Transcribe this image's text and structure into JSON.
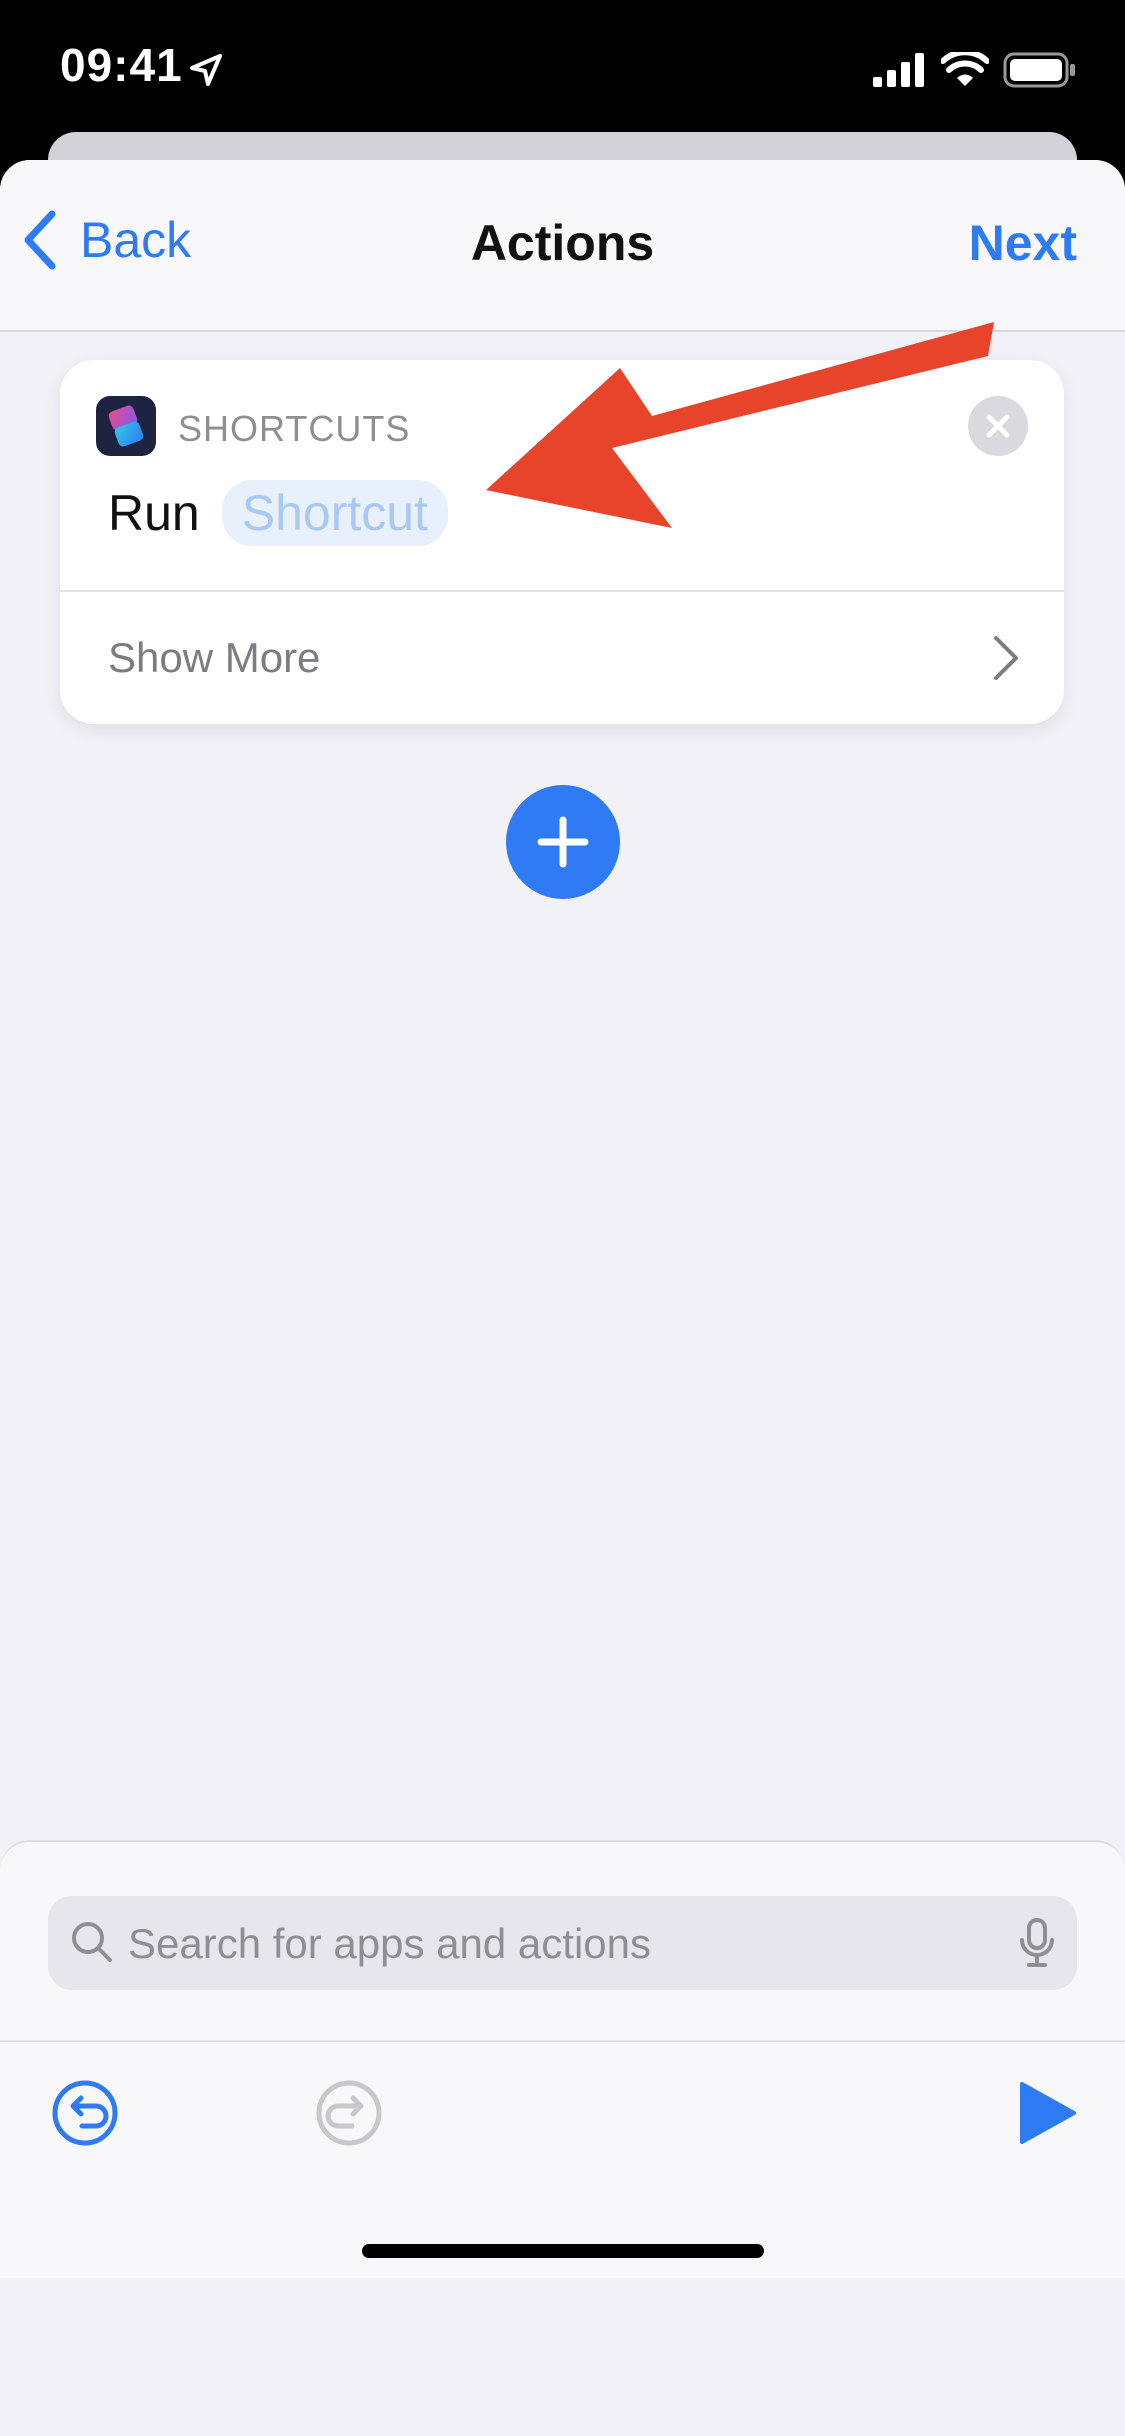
{
  "status_bar": {
    "time": "09:41"
  },
  "nav": {
    "back_label": "Back",
    "title": "Actions",
    "next_label": "Next"
  },
  "action_card": {
    "app_name": "SHORTCUTS",
    "action_verb": "Run",
    "parameter_token": "Shortcut",
    "show_more_label": "Show More"
  },
  "search": {
    "placeholder": "Search for apps and actions"
  },
  "icons": {
    "status": [
      "location-arrow-icon",
      "cellular-signal-icon",
      "wifi-icon",
      "battery-icon"
    ],
    "nav": [
      "chevron-left-icon"
    ],
    "card": [
      "shortcuts-app-icon",
      "close-icon",
      "chevron-right-icon"
    ],
    "bottom": [
      "search-icon",
      "microphone-icon",
      "undo-icon",
      "redo-icon",
      "play-icon",
      "plus-icon"
    ]
  },
  "colors": {
    "accent": "#2f7bf5",
    "annotation_arrow": "#e8442b",
    "sheet_background": "#f1f1f6",
    "token_background": "#e8f0fc",
    "token_text": "#a9c9f3"
  }
}
